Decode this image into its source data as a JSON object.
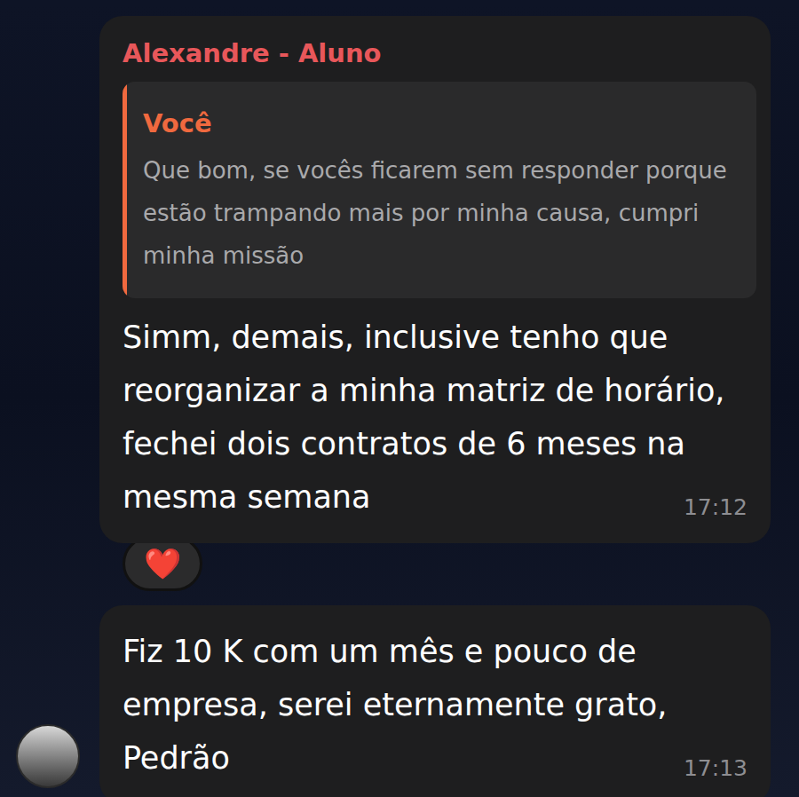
{
  "messages": [
    {
      "sender": "Alexandre - Aluno",
      "quote": {
        "author": "Você",
        "text": "Que bom, se vocês ficarem sem responder porque estão trampando mais por minha causa, cumpri minha missão"
      },
      "text": "Simm, demais, inclusive tenho que reorganizar a minha matriz de horário, fechei dois contratos de 6 meses na mesma semana",
      "time": "17:12",
      "reactions": [
        "❤️"
      ],
      "avatar": false
    },
    {
      "sender": null,
      "quote": null,
      "text": "Fiz 10 K com um mês e pouco de empresa, serei eternamente grato, Pedrão",
      "time": "17:13",
      "reactions": [],
      "avatar": true
    }
  ]
}
